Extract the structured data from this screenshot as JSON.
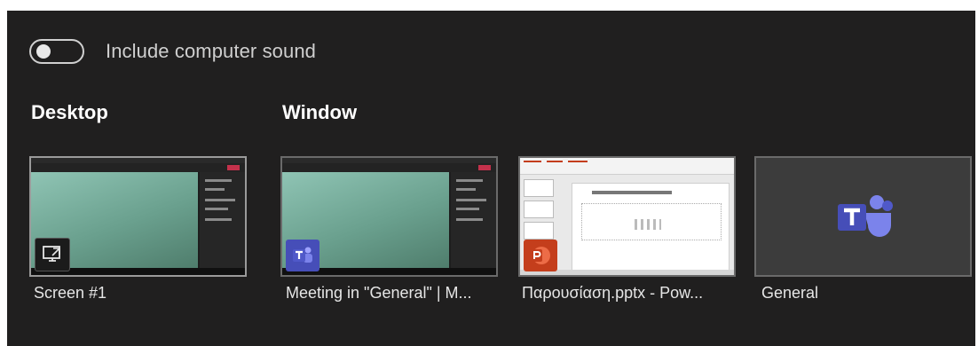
{
  "sound_toggle": {
    "label": "Include computer sound",
    "on": false
  },
  "sections": {
    "desktop": "Desktop",
    "window": "Window"
  },
  "tiles": [
    {
      "caption": "Screen #1"
    },
    {
      "caption": "Meeting in \"General\" | M..."
    },
    {
      "caption": "Παρουσίαση.pptx - Pow..."
    },
    {
      "caption": "General"
    }
  ],
  "icons": {
    "screen": "screen-share-icon",
    "teams": "teams-icon",
    "powerpoint": "powerpoint-icon"
  },
  "colors": {
    "panel_bg": "#201f1f",
    "teams_purple": "#464eb8",
    "ppt_orange": "#c43e1c"
  }
}
